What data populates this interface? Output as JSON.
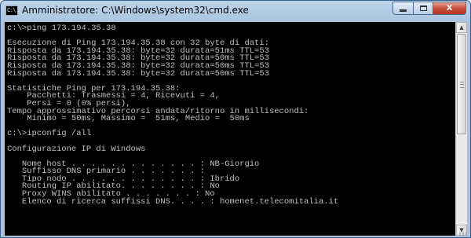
{
  "window": {
    "title": "Amministratore: C:\\Windows\\system32\\cmd.exe",
    "icon_text": "C:\\.",
    "icon": "cmd-icon",
    "buttons": {
      "minimize": "minimize-icon",
      "maximize": "maximize-icon",
      "close": "close-icon",
      "close_label": "X"
    }
  },
  "console": {
    "text_color": "#c0c0c0",
    "background": "#000000",
    "lines": [
      "c:\\>ping 173.194.35.38",
      "",
      "Esecuzione di Ping 173.194.35.38 con 32 byte di dati:",
      "Risposta da 173.194.35.38: byte=32 durata=51ms TTL=53",
      "Risposta da 173.194.35.38: byte=32 durata=50ms TTL=53",
      "Risposta da 173.194.35.38: byte=32 durata=50ms TTL=53",
      "Risposta da 173.194.35.38: byte=32 durata=50ms TTL=53",
      "",
      "Statistiche Ping per 173.194.35.38:",
      "    Pacchetti: Trasmessi = 4, Ricevuti = 4,",
      "    Persi = 0 (0% persi),",
      "Tempo approssimativo percorsi andata/ritorno in millisecondi:",
      "    Minimo = 50ms, Massimo =  51ms, Medio =  50ms",
      "",
      "c:\\>ipconfig /all",
      "",
      "Configurazione IP di Windows",
      "",
      "   Nome host . . . . . . . . . . . . . : NB-Giorgio",
      "   Suffisso DNS primario . . . . . . . :",
      "   Tipo nodo . . . . . . . . . . . . . : Ibrido",
      "   Routing IP abilitato. . . . . . . . : No",
      "   Proxy WINS abilitato . . . . . . . : No",
      "   Elenco di ricerca suffissi DNS. . . . : homenet.telecomitalia.it"
    ]
  },
  "scrollbar": {
    "up_arrow": "scroll-up-arrow-icon",
    "down_arrow": "scroll-down-arrow-icon",
    "up_glyph": "▲",
    "down_glyph": "▼"
  }
}
